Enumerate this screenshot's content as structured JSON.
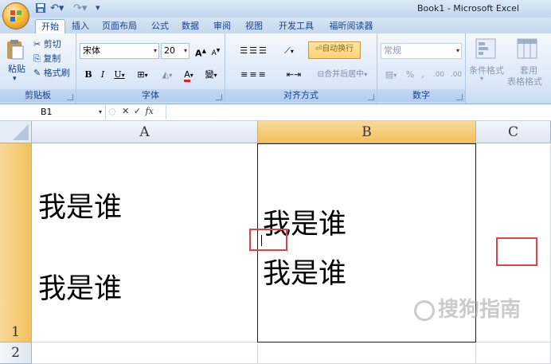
{
  "window": {
    "title": "Book1 - Microsoft Excel"
  },
  "tabs": [
    "开始",
    "插入",
    "页面布局",
    "公式",
    "数据",
    "审阅",
    "视图",
    "开发工具",
    "福昕阅读器"
  ],
  "ribbon": {
    "clipboard": {
      "paste": "粘贴",
      "cut": "剪切",
      "copy": "复制",
      "format_painter": "格式刷",
      "label": "剪贴板"
    },
    "font": {
      "name": "宋体",
      "size": "20",
      "bold": "B",
      "italic": "I",
      "underline": "U",
      "grow": "A",
      "shrink": "A",
      "color_glyph": "A",
      "phonetic": "變",
      "label": "字体"
    },
    "alignment": {
      "wrap_text": "自动换行",
      "merge_center": "合并后居中",
      "label": "对齐方式"
    },
    "number": {
      "format": "常规",
      "percent": "%",
      "comma": ",",
      "inc_decimal": ".00",
      "dec_decimal": ".00",
      "label": "数字"
    },
    "styles": {
      "conditional": "条件格式",
      "table_format_1": "套用",
      "table_format_2": "表格格式"
    }
  },
  "formula_bar": {
    "name_box": "B1",
    "fx": "fx"
  },
  "grid": {
    "columns": [
      "A",
      "B",
      "C"
    ],
    "rows": [
      "1",
      "2"
    ],
    "cells": {
      "A1_line1": "我是谁",
      "A1_line2": "我是谁",
      "B1_line1": "我是谁",
      "B1_line2": "我是谁"
    }
  },
  "watermark": "搜狗指南",
  "colors": {
    "selection_header": "#f1c05c",
    "annotation_box": "#e0444a",
    "ribbon_bg": "#dbe8f8"
  }
}
